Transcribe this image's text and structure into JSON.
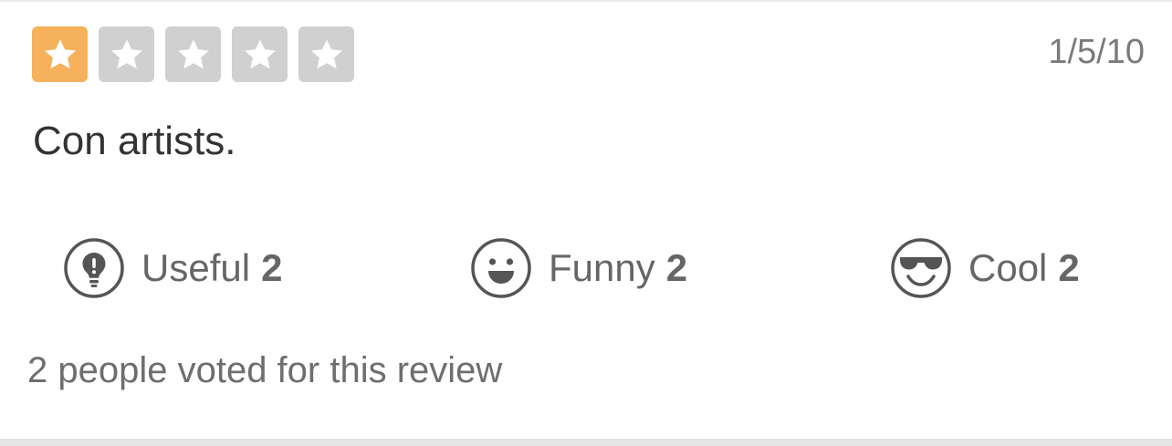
{
  "review": {
    "rating": 1,
    "rating_max": 5,
    "date": "1/5/10",
    "text": "Con artists."
  },
  "votes": {
    "useful": {
      "label": "Useful",
      "count": "2",
      "icon": "lightbulb-icon"
    },
    "funny": {
      "label": "Funny",
      "count": "2",
      "icon": "smiley-icon"
    },
    "cool": {
      "label": "Cool",
      "count": "2",
      "icon": "sunglasses-icon"
    },
    "summary": "2 people voted for this review"
  },
  "colors": {
    "star_active": "#f6b15c",
    "star_inactive": "#d0d0d0",
    "icon_stroke": "#555555"
  }
}
